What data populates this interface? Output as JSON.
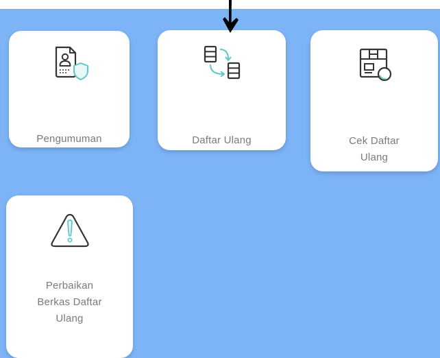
{
  "menu": {
    "tiles": [
      {
        "label": "Pengumuman",
        "icon": "announcement-document-icon"
      },
      {
        "label": "Daftar Ulang",
        "icon": "re-registration-icon"
      },
      {
        "label": "Cek Daftar\nUlang",
        "icon": "check-registration-icon"
      },
      {
        "label": "Perbaikan\nBerkas Daftar\nUlang",
        "icon": "warning-icon"
      }
    ]
  },
  "annotation": {
    "icon": "pointer-arrow-icon"
  },
  "colors": {
    "background": "#7db4f5",
    "tile": "#ffffff",
    "icon_dark": "#333333",
    "icon_accent": "#5ec8c8",
    "label": "#7a7a7a"
  }
}
